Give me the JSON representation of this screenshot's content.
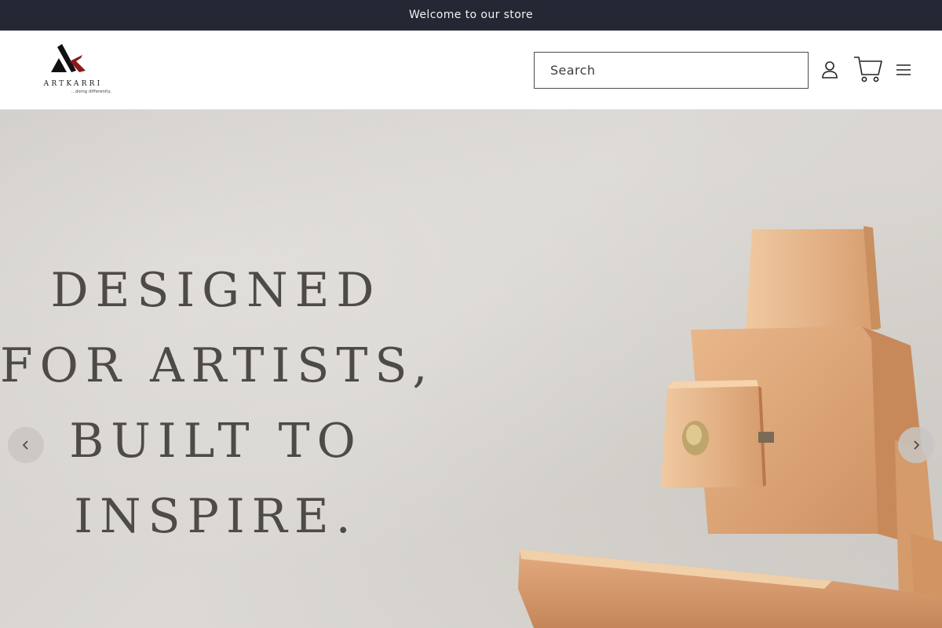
{
  "announcement": {
    "text": "Welcome to our store"
  },
  "header": {
    "logo": {
      "wordmark": "ARTKARRI",
      "tagline": "...doing differently."
    },
    "search": {
      "placeholder": "Search"
    },
    "icons": {
      "account": "account-icon",
      "cart": "cart-icon",
      "menu": "hamburger-menu-icon"
    }
  },
  "hero": {
    "lines": [
      "DESIGNED",
      "FOR ARTISTS,",
      "BUILT TO",
      "INSPIRE."
    ],
    "prev_icon": "chevron-left-icon",
    "next_icon": "chevron-right-icon",
    "image": "wooden-easel-image"
  },
  "colors": {
    "announcement_bg": "#232834",
    "hero_text": "#4e4b47",
    "logo_red": "#8b1a1a",
    "wood": "#d9a57a"
  }
}
